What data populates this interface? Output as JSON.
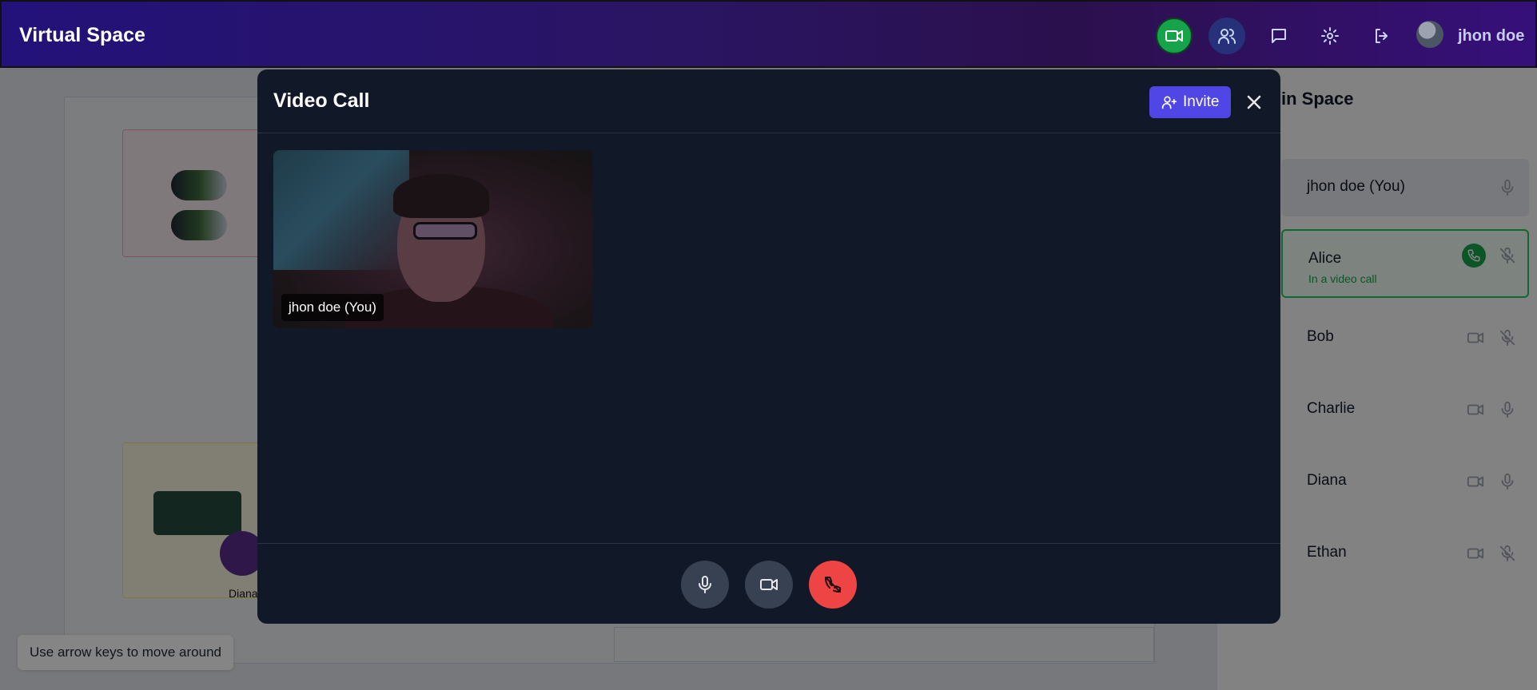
{
  "app": {
    "title": "Virtual Space",
    "user_name": "jhon doe",
    "accent": "#4f46e5"
  },
  "toolbar": {
    "video_icon": "video-icon",
    "people_icon": "users-icon",
    "chat_icon": "message-icon",
    "settings_icon": "gear-icon",
    "logout_icon": "logout-icon"
  },
  "workspace": {
    "hint": "Use arrow keys to move around",
    "avatar_label": "Diana"
  },
  "panel": {
    "title": "in Space",
    "participants": [
      {
        "name": "jhon doe (You)",
        "status": "",
        "mic": "on"
      },
      {
        "name": "Alice",
        "status": "In a video call",
        "mic": "off",
        "in_call": true
      },
      {
        "name": "Bob",
        "status": "",
        "mic": "off"
      },
      {
        "name": "Charlie",
        "status": "",
        "mic": "on"
      },
      {
        "name": "Diana",
        "status": "",
        "mic": "on"
      },
      {
        "name": "Ethan",
        "status": "",
        "mic": "off"
      }
    ]
  },
  "modal": {
    "title": "Video Call",
    "invite_label": "Invite",
    "video_label": "jhon doe (You)",
    "controls": {
      "mic": "mic-icon",
      "camera": "camera-icon",
      "end_call": "phone-off-icon",
      "end_color": "#ef4444"
    }
  }
}
